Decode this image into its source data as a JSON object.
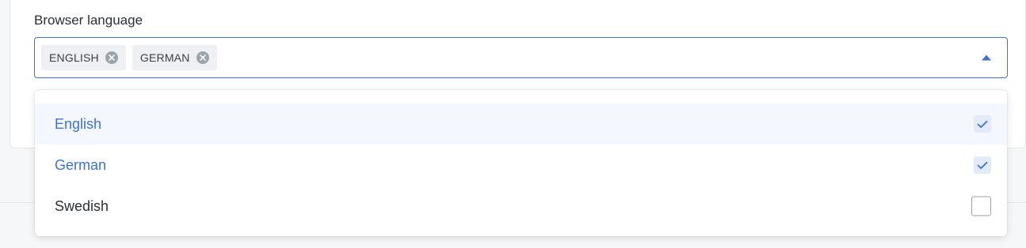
{
  "field": {
    "label": "Browser language"
  },
  "selected_chips": [
    {
      "label": "ENGLISH",
      "remove_icon": "close-circle-icon"
    },
    {
      "label": "GERMAN",
      "remove_icon": "close-circle-icon"
    }
  ],
  "select": {
    "caret_icon": "caret-up-icon",
    "expanded": true
  },
  "options": [
    {
      "label": "English",
      "checked": true,
      "highlighted": true
    },
    {
      "label": "German",
      "checked": true,
      "highlighted": false
    },
    {
      "label": "Swedish",
      "checked": false,
      "highlighted": false
    }
  ],
  "colors": {
    "accent": "#3b72d9",
    "chip_bg": "#eef0f3",
    "highlight_bg": "#f4f7fd",
    "check_bg": "#e3ebfa"
  }
}
